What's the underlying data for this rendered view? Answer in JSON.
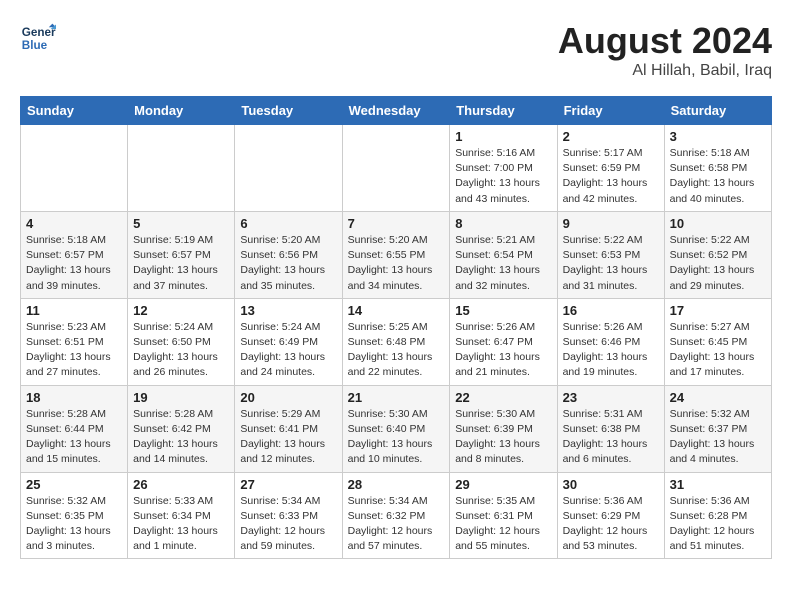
{
  "header": {
    "logo_line1": "General",
    "logo_line2": "Blue",
    "month_year": "August 2024",
    "location": "Al Hillah, Babil, Iraq"
  },
  "weekdays": [
    "Sunday",
    "Monday",
    "Tuesday",
    "Wednesday",
    "Thursday",
    "Friday",
    "Saturday"
  ],
  "weeks": [
    [
      {
        "day": "",
        "detail": ""
      },
      {
        "day": "",
        "detail": ""
      },
      {
        "day": "",
        "detail": ""
      },
      {
        "day": "",
        "detail": ""
      },
      {
        "day": "1",
        "detail": "Sunrise: 5:16 AM\nSunset: 7:00 PM\nDaylight: 13 hours\nand 43 minutes."
      },
      {
        "day": "2",
        "detail": "Sunrise: 5:17 AM\nSunset: 6:59 PM\nDaylight: 13 hours\nand 42 minutes."
      },
      {
        "day": "3",
        "detail": "Sunrise: 5:18 AM\nSunset: 6:58 PM\nDaylight: 13 hours\nand 40 minutes."
      }
    ],
    [
      {
        "day": "4",
        "detail": "Sunrise: 5:18 AM\nSunset: 6:57 PM\nDaylight: 13 hours\nand 39 minutes."
      },
      {
        "day": "5",
        "detail": "Sunrise: 5:19 AM\nSunset: 6:57 PM\nDaylight: 13 hours\nand 37 minutes."
      },
      {
        "day": "6",
        "detail": "Sunrise: 5:20 AM\nSunset: 6:56 PM\nDaylight: 13 hours\nand 35 minutes."
      },
      {
        "day": "7",
        "detail": "Sunrise: 5:20 AM\nSunset: 6:55 PM\nDaylight: 13 hours\nand 34 minutes."
      },
      {
        "day": "8",
        "detail": "Sunrise: 5:21 AM\nSunset: 6:54 PM\nDaylight: 13 hours\nand 32 minutes."
      },
      {
        "day": "9",
        "detail": "Sunrise: 5:22 AM\nSunset: 6:53 PM\nDaylight: 13 hours\nand 31 minutes."
      },
      {
        "day": "10",
        "detail": "Sunrise: 5:22 AM\nSunset: 6:52 PM\nDaylight: 13 hours\nand 29 minutes."
      }
    ],
    [
      {
        "day": "11",
        "detail": "Sunrise: 5:23 AM\nSunset: 6:51 PM\nDaylight: 13 hours\nand 27 minutes."
      },
      {
        "day": "12",
        "detail": "Sunrise: 5:24 AM\nSunset: 6:50 PM\nDaylight: 13 hours\nand 26 minutes."
      },
      {
        "day": "13",
        "detail": "Sunrise: 5:24 AM\nSunset: 6:49 PM\nDaylight: 13 hours\nand 24 minutes."
      },
      {
        "day": "14",
        "detail": "Sunrise: 5:25 AM\nSunset: 6:48 PM\nDaylight: 13 hours\nand 22 minutes."
      },
      {
        "day": "15",
        "detail": "Sunrise: 5:26 AM\nSunset: 6:47 PM\nDaylight: 13 hours\nand 21 minutes."
      },
      {
        "day": "16",
        "detail": "Sunrise: 5:26 AM\nSunset: 6:46 PM\nDaylight: 13 hours\nand 19 minutes."
      },
      {
        "day": "17",
        "detail": "Sunrise: 5:27 AM\nSunset: 6:45 PM\nDaylight: 13 hours\nand 17 minutes."
      }
    ],
    [
      {
        "day": "18",
        "detail": "Sunrise: 5:28 AM\nSunset: 6:44 PM\nDaylight: 13 hours\nand 15 minutes."
      },
      {
        "day": "19",
        "detail": "Sunrise: 5:28 AM\nSunset: 6:42 PM\nDaylight: 13 hours\nand 14 minutes."
      },
      {
        "day": "20",
        "detail": "Sunrise: 5:29 AM\nSunset: 6:41 PM\nDaylight: 13 hours\nand 12 minutes."
      },
      {
        "day": "21",
        "detail": "Sunrise: 5:30 AM\nSunset: 6:40 PM\nDaylight: 13 hours\nand 10 minutes."
      },
      {
        "day": "22",
        "detail": "Sunrise: 5:30 AM\nSunset: 6:39 PM\nDaylight: 13 hours\nand 8 minutes."
      },
      {
        "day": "23",
        "detail": "Sunrise: 5:31 AM\nSunset: 6:38 PM\nDaylight: 13 hours\nand 6 minutes."
      },
      {
        "day": "24",
        "detail": "Sunrise: 5:32 AM\nSunset: 6:37 PM\nDaylight: 13 hours\nand 4 minutes."
      }
    ],
    [
      {
        "day": "25",
        "detail": "Sunrise: 5:32 AM\nSunset: 6:35 PM\nDaylight: 13 hours\nand 3 minutes."
      },
      {
        "day": "26",
        "detail": "Sunrise: 5:33 AM\nSunset: 6:34 PM\nDaylight: 13 hours\nand 1 minute."
      },
      {
        "day": "27",
        "detail": "Sunrise: 5:34 AM\nSunset: 6:33 PM\nDaylight: 12 hours\nand 59 minutes."
      },
      {
        "day": "28",
        "detail": "Sunrise: 5:34 AM\nSunset: 6:32 PM\nDaylight: 12 hours\nand 57 minutes."
      },
      {
        "day": "29",
        "detail": "Sunrise: 5:35 AM\nSunset: 6:31 PM\nDaylight: 12 hours\nand 55 minutes."
      },
      {
        "day": "30",
        "detail": "Sunrise: 5:36 AM\nSunset: 6:29 PM\nDaylight: 12 hours\nand 53 minutes."
      },
      {
        "day": "31",
        "detail": "Sunrise: 5:36 AM\nSunset: 6:28 PM\nDaylight: 12 hours\nand 51 minutes."
      }
    ]
  ]
}
